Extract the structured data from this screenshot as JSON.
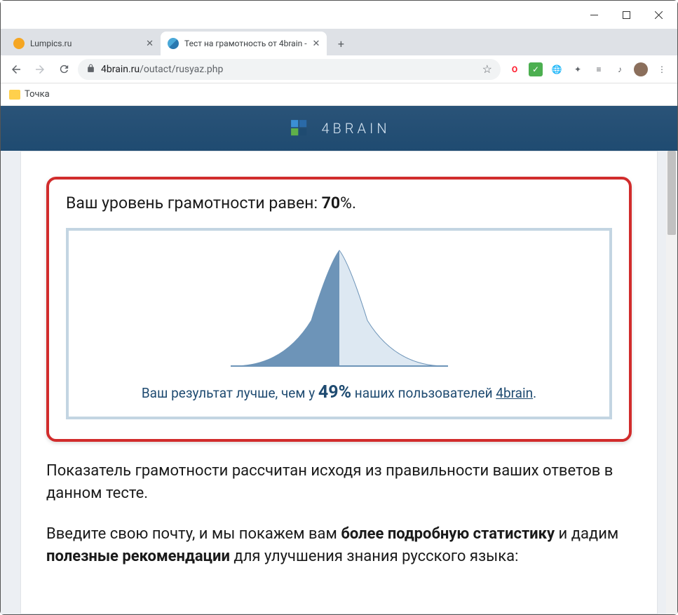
{
  "window": {
    "tabs": [
      {
        "title": "Lumpics.ru",
        "favicon_color": "#f5a623",
        "active": false
      },
      {
        "title": "Тест на грамотность от 4brain -",
        "favicon_color": "#4aa8d8",
        "active": true
      }
    ]
  },
  "toolbar": {
    "url_host": "4brain.ru",
    "url_path": "/outact/rusyaz.php"
  },
  "bookmarks": {
    "item1": "Точка"
  },
  "brand": {
    "name": "4BRAIN"
  },
  "result": {
    "headline_prefix": "Ваш уровень грамотности равен: ",
    "percent_value": "70",
    "percent_suffix": "%.",
    "caption_prefix": "Ваш результат лучше, чем у ",
    "caption_percent": "49%",
    "caption_suffix": " наших пользователей ",
    "caption_link": "4brain",
    "caption_end": "."
  },
  "body": {
    "para1": "Показатель грамотности рассчитан исходя из правильности ваших ответов в данном тесте.",
    "para2_a": "Введите свою почту, и мы покажем вам ",
    "para2_b": "более подробную статистику",
    "para2_c": " и дадим ",
    "para2_d": "полезные рекомендации",
    "para2_e": " для улучшения знания русского языка:"
  },
  "chart_data": {
    "type": "area",
    "title": "Normal distribution of user results",
    "x_range": [
      0,
      100
    ],
    "user_percentile": 49,
    "fill_left_color": "#6d94b8",
    "fill_right_color": "#dde8f2",
    "baseline_color": "#6d94b8",
    "curve_points": [
      {
        "x": 0,
        "y": 0.0
      },
      {
        "x": 10,
        "y": 0.02
      },
      {
        "x": 20,
        "y": 0.08
      },
      {
        "x": 30,
        "y": 0.22
      },
      {
        "x": 40,
        "y": 0.55
      },
      {
        "x": 45,
        "y": 0.8
      },
      {
        "x": 50,
        "y": 1.0
      },
      {
        "x": 55,
        "y": 0.8
      },
      {
        "x": 60,
        "y": 0.55
      },
      {
        "x": 70,
        "y": 0.22
      },
      {
        "x": 80,
        "y": 0.08
      },
      {
        "x": 90,
        "y": 0.02
      },
      {
        "x": 100,
        "y": 0.0
      }
    ]
  }
}
